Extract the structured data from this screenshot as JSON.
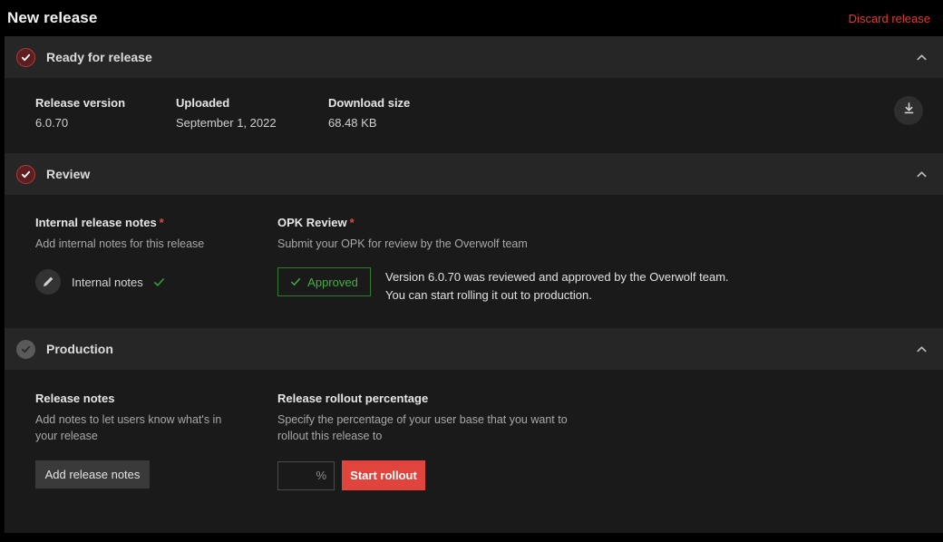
{
  "header": {
    "title": "New release",
    "discard_label": "Discard release",
    "discard_color": "#e03b34"
  },
  "sections": [
    {
      "key": "ready",
      "title": "Ready for release",
      "status_icon": "check-circle-icon",
      "status": "done",
      "collapse_icon": "chevron-up-icon",
      "fields": [
        {
          "label": "Release version",
          "value": "6.0.70"
        },
        {
          "label": "Uploaded",
          "value": "September 1, 2022"
        },
        {
          "label": "Download size",
          "value": "68.48 KB"
        }
      ],
      "download_icon": "download-icon"
    },
    {
      "key": "review",
      "title": "Review",
      "status_icon": "check-circle-icon",
      "status": "done",
      "collapse_icon": "chevron-up-icon",
      "internal": {
        "label": "Internal release notes",
        "required_mark": "*",
        "description": "Add internal notes for this release",
        "edit_icon": "pencil-icon",
        "notes_label": "Internal notes",
        "done_icon": "check-icon",
        "done_color": "#35a135"
      },
      "opk": {
        "label": "OPK Review",
        "required_mark": "*",
        "description": "Submit your OPK for review by the Overwolf team",
        "badge_icon": "check-icon",
        "badge_label": "Approved",
        "badge_color": "#43b043",
        "message_line1": "Version 6.0.70 was reviewed and approved by the Overwolf team.",
        "message_line2": "You can start rolling it out to production."
      }
    },
    {
      "key": "production",
      "title": "Production",
      "status_icon": "check-circle-icon",
      "status": "pending",
      "collapse_icon": "chevron-up-icon",
      "release_notes": {
        "label": "Release notes",
        "description": "Add notes to let users know what's in your release",
        "button_label": "Add release notes"
      },
      "rollout": {
        "label": "Release rollout percentage",
        "description": "Specify the percentage of your user base that you want to rollout this release to",
        "input_value": "",
        "input_placeholder": "%",
        "button_label": "Start rollout",
        "button_color": "#e0443c"
      }
    }
  ]
}
